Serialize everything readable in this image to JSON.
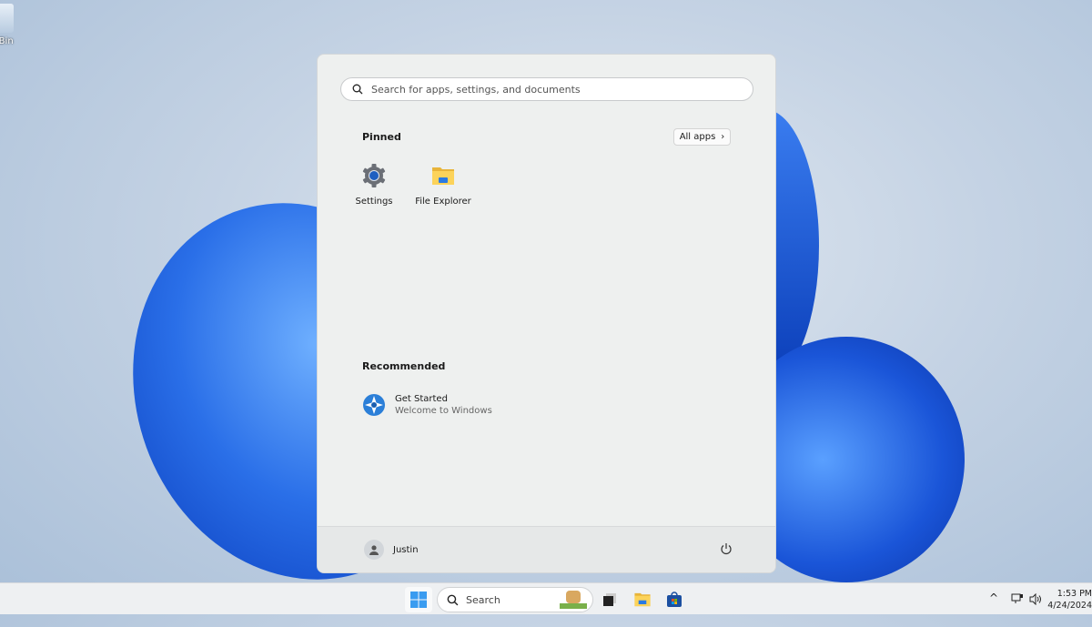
{
  "desktop": {
    "recycle_bin_label": "e Bin"
  },
  "start_menu": {
    "search_placeholder": "Search for apps, settings, and documents",
    "pinned": {
      "title": "Pinned",
      "all_apps_label": "All apps",
      "apps": [
        {
          "label": "Settings",
          "icon": "gear-icon"
        },
        {
          "label": "File Explorer",
          "icon": "folder-icon"
        }
      ]
    },
    "recommended": {
      "title": "Recommended",
      "items": [
        {
          "title": "Get Started",
          "subtitle": "Welcome to Windows",
          "icon": "get-started-icon"
        }
      ]
    },
    "user": {
      "name": "Justin"
    },
    "power_icon": "power-icon"
  },
  "taskbar": {
    "search_label": "Search",
    "clock": {
      "time": "1:53 PM",
      "date": "4/24/2024"
    }
  },
  "colors": {
    "accent": "#0067c0",
    "wallpaper_bloom": "#1e5fe0"
  }
}
